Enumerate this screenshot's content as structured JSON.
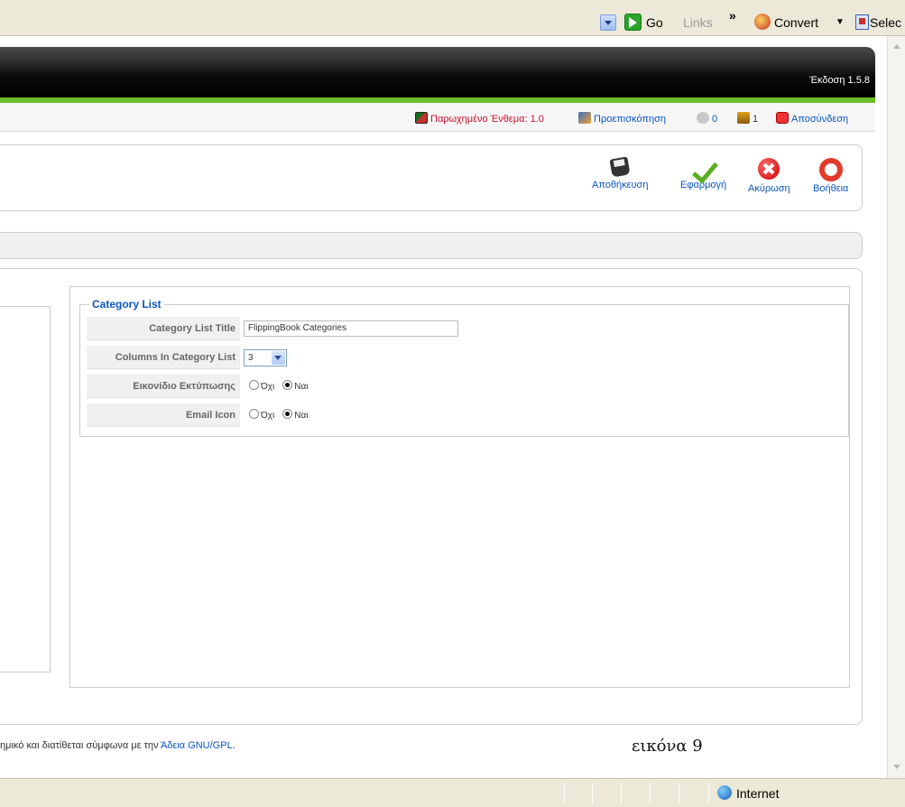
{
  "ie_toolbar": {
    "go_label": "Go",
    "links_label": "Links",
    "chevron": "»",
    "convert_label": "Convert",
    "select_label": "Selec"
  },
  "header": {
    "version": "Έκδοση 1.5.8"
  },
  "status_bar": {
    "checked_out": "Παρωχημένο Ένθεμα: 1.0",
    "preview": "Προεπισκόπηση",
    "messages_count": "0",
    "users_count": "1",
    "logout": "Αποσύνδεση"
  },
  "toolbar": {
    "save": "Αποθήκευση",
    "apply": "Εφαρμογή",
    "cancel": "Ακύρωση",
    "help": "Βοήθεια"
  },
  "category_list": {
    "legend": "Category List",
    "rows": [
      {
        "label": "Category List Title",
        "value": "FlippingBook Categories"
      },
      {
        "label": "Columns In Category List",
        "value": "3"
      },
      {
        "label": "Εικονίδιο Εκτύπωσης",
        "opt_no": "Όχι",
        "opt_yes": "Ναι",
        "selected": "Ναι"
      },
      {
        "label": "Email Icon",
        "opt_no": "Όχι",
        "opt_yes": "Ναι",
        "selected": "Ναι"
      }
    ]
  },
  "footer": {
    "text": "ημικό και διατίθεται σύμφωνα με την ",
    "link": "Άδεια GNU/GPL",
    "suffix": "."
  },
  "caption": "εικόνα  9",
  "ie_status": {
    "zone": "Internet"
  }
}
